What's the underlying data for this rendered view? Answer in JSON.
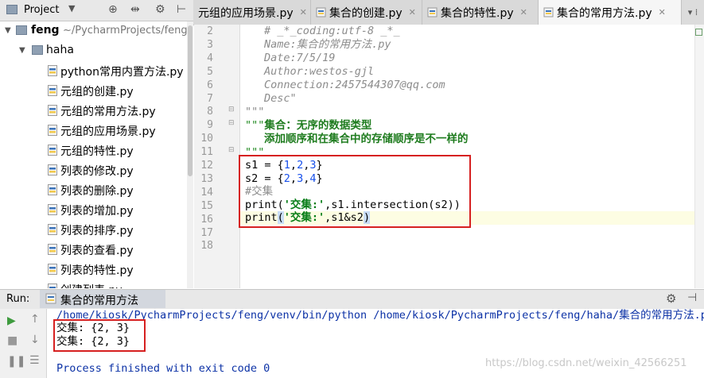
{
  "project_panel": {
    "title": "Project",
    "dropdown_icon": "chevron-down-icon",
    "tools": [
      "target-icon",
      "split-icon",
      "gear-icon",
      "hide-icon"
    ]
  },
  "tabs": [
    {
      "label": "元组的应用场景.py",
      "active": false
    },
    {
      "label": "集合的创建.py",
      "active": false
    },
    {
      "label": "集合的特性.py",
      "active": false
    },
    {
      "label": "集合的常用方法.py",
      "active": true
    }
  ],
  "tab_overflow_label": "▾ ⁞",
  "tree": {
    "root": {
      "name": "feng",
      "path": "~/PycharmProjects/feng"
    },
    "folder": "haha",
    "files": [
      "python常用内置方法.py",
      "元组的创建.py",
      "元组的常用方法.py",
      "元组的应用场景.py",
      "元组的特性.py",
      "列表的修改.py",
      "列表的删除.py",
      "列表的增加.py",
      "列表的排序.py",
      "列表的查看.py",
      "列表的特性.py",
      "创建列表.py"
    ]
  },
  "editor": {
    "line_numbers": [
      "2",
      "3",
      "4",
      "5",
      "6",
      "7",
      "8",
      "9",
      "10",
      "11",
      "12",
      "13",
      "14",
      "15",
      "16",
      "17",
      "18"
    ],
    "header_comments": [
      "# _*_coding:utf-8 _*_",
      "Name:集合的常用方法.py",
      "Date:7/5/19",
      "Author:westos-gjl",
      "Connection:2457544307@qq.com",
      "Desc\""
    ],
    "line8": "\"\"\"",
    "doc_line9_quotes": "\"\"\"",
    "doc_line9_text": "集合：无序的数据类型",
    "doc_line10": "添加顺序和在集合中的存储顺序是不一样的",
    "doc_line11": "\"\"\"",
    "code": {
      "l12_a": "s1 = {",
      "l12_n1": "1",
      "l12_c1": ",",
      "l12_n2": "2",
      "l12_c2": ",",
      "l12_n3": "3",
      "l12_b": "}",
      "l13_a": "s2 = {",
      "l13_n1": "2",
      "l13_c1": ",",
      "l13_n2": "3",
      "l13_c2": ",",
      "l13_n3": "4",
      "l13_b": "}",
      "l14": "#交集",
      "l15_a": "print(",
      "l15_s": "'交集:'",
      "l15_b": ",s1.intersection(s2))",
      "l16_a": "print",
      "l16_p": "(",
      "l16_s": "'交集:'",
      "l16_b": ",s1&s2",
      "l16_c": ")"
    }
  },
  "run": {
    "label": "Run:",
    "tab": "集合的常用方法",
    "command": "/home/kiosk/PycharmProjects/feng/venv/bin/python /home/kiosk/PycharmProjects/feng/haha/集合的常用方法.py",
    "output": [
      "交集: {2, 3}",
      "交集: {2, 3}"
    ],
    "exit": "Process finished with exit code 0"
  },
  "watermark": "https://blog.csdn.net/weixin_42566251"
}
